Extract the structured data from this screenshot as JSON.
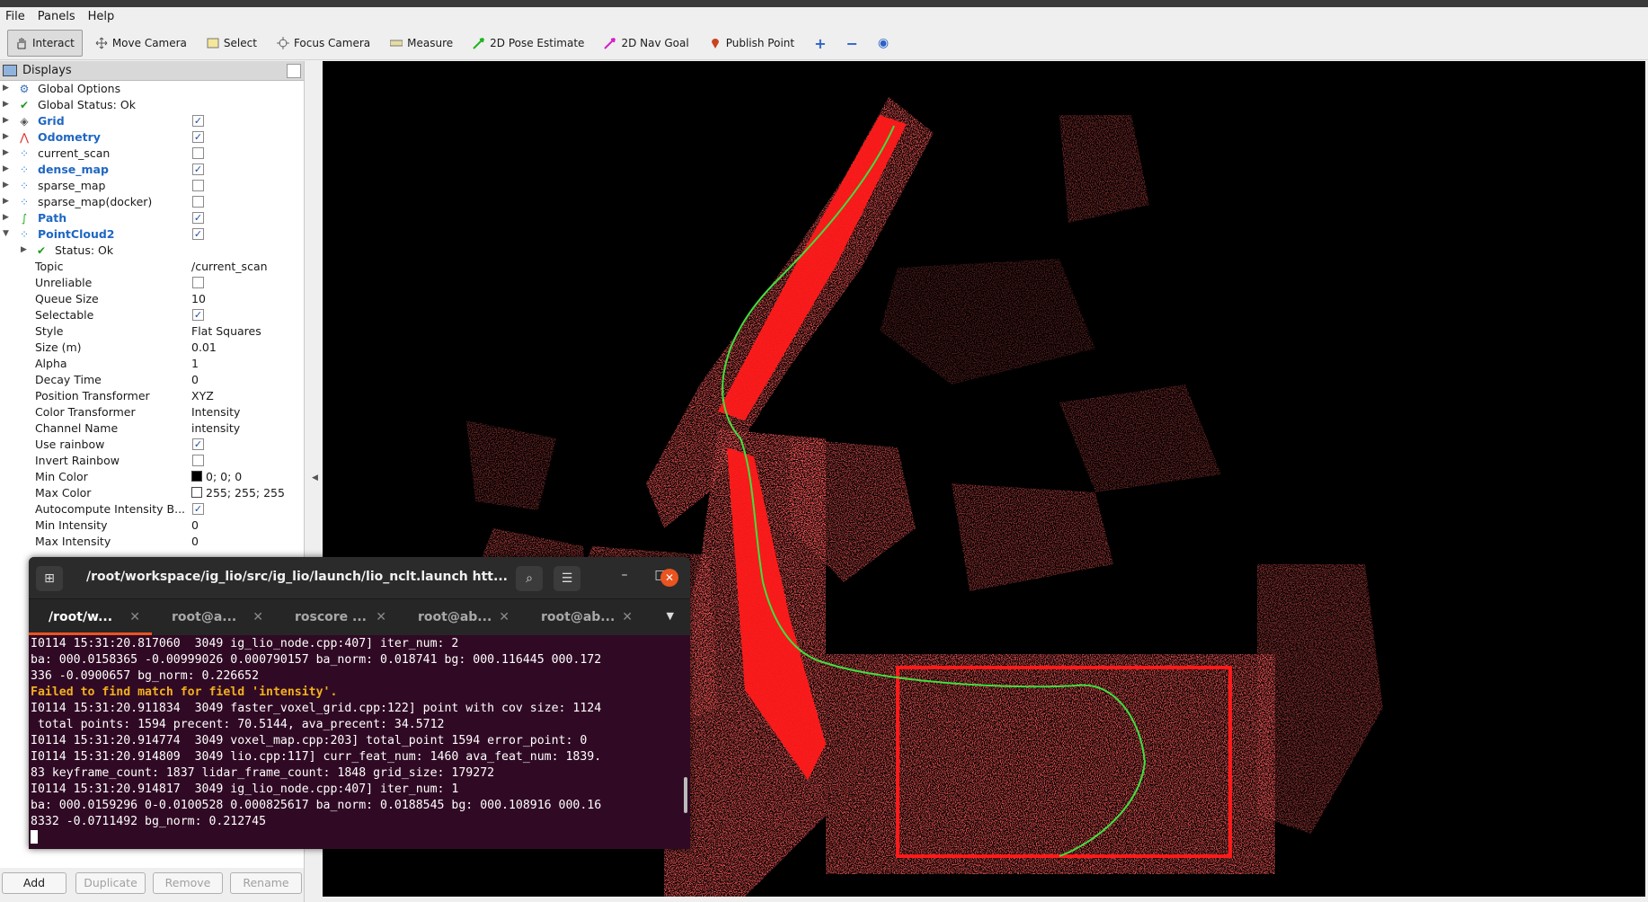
{
  "menu": [
    "File",
    "Panels",
    "Help"
  ],
  "toolbar": {
    "tools": [
      "Interact",
      "Move Camera",
      "Select",
      "Focus Camera",
      "Measure",
      "2D Pose Estimate",
      "2D Nav Goal",
      "Publish Point"
    ],
    "zoom_in": "+",
    "zoom_out": "−",
    "view": "◉"
  },
  "displays": {
    "title": "Displays",
    "items": [
      {
        "label": "Global Options",
        "icon": "globe-icon",
        "checked": null,
        "bold": false
      },
      {
        "label": "Global Status: Ok",
        "icon": "check-icon",
        "checked": null,
        "bold": false
      },
      {
        "label": "Grid",
        "icon": "grid-icon",
        "checked": true,
        "bold": true
      },
      {
        "label": "Odometry",
        "icon": "odometry-icon",
        "checked": true,
        "bold": true
      },
      {
        "label": "current_scan",
        "icon": "pointcloud-icon",
        "checked": false,
        "bold": false
      },
      {
        "label": "dense_map",
        "icon": "pointcloud-icon",
        "checked": true,
        "bold": true
      },
      {
        "label": "sparse_map",
        "icon": "pointcloud-icon",
        "checked": false,
        "bold": false
      },
      {
        "label": "sparse_map(docker)",
        "icon": "pointcloud-icon",
        "checked": false,
        "bold": false
      },
      {
        "label": "Path",
        "icon": "path-icon",
        "checked": true,
        "bold": true
      },
      {
        "label": "PointCloud2",
        "icon": "pointcloud-icon",
        "checked": true,
        "bold": true
      }
    ],
    "status_ok": "Status: Ok",
    "properties": [
      {
        "label": "Topic",
        "value": "/current_scan"
      },
      {
        "label": "Unreliable",
        "value": "",
        "checkbox": false
      },
      {
        "label": "Queue Size",
        "value": "10"
      },
      {
        "label": "Selectable",
        "value": "",
        "checkbox": true
      },
      {
        "label": "Style",
        "value": "Flat Squares"
      },
      {
        "label": "Size (m)",
        "value": "0.01"
      },
      {
        "label": "Alpha",
        "value": "1"
      },
      {
        "label": "Decay Time",
        "value": "0"
      },
      {
        "label": "Position Transformer",
        "value": "XYZ"
      },
      {
        "label": "Color Transformer",
        "value": "Intensity"
      },
      {
        "label": "Channel Name",
        "value": "intensity"
      },
      {
        "label": "Use rainbow",
        "value": "",
        "checkbox": true
      },
      {
        "label": "Invert Rainbow",
        "value": "",
        "checkbox": false
      },
      {
        "label": "Min Color",
        "value": "0; 0; 0",
        "swatch": "#000000"
      },
      {
        "label": "Max Color",
        "value": "255; 255; 255",
        "swatch": "#ffffff"
      },
      {
        "label": "Autocompute Intensity B...",
        "value": "",
        "checkbox": true
      },
      {
        "label": "Min Intensity",
        "value": "0"
      },
      {
        "label": "Max Intensity",
        "value": "0"
      }
    ]
  },
  "buttons": {
    "add": "Add",
    "duplicate": "Duplicate",
    "remove": "Remove",
    "rename": "Rename"
  },
  "terminal": {
    "title": "/root/workspace/ig_lio/src/ig_lio/launch/lio_nclt.launch htt...",
    "tabs": [
      "/root/w...",
      "root@a...",
      "roscore ...",
      "root@ab...",
      "root@ab..."
    ],
    "lines": [
      {
        "text": "I0114 15:31:20.817060  3049 ig_lio_node.cpp:407] iter_num: 2",
        "warn": false
      },
      {
        "text": "ba: 000.0158365 -0.00999026 0.000790157 ba_norm: 0.018741 bg: 000.116445 000.172",
        "warn": false
      },
      {
        "text": "336 -0.0900657 bg_norm: 0.226652",
        "warn": false
      },
      {
        "text": "Failed to find match for field 'intensity'.",
        "warn": true
      },
      {
        "text": "I0114 15:31:20.911834  3049 faster_voxel_grid.cpp:122] point with cov size: 1124",
        "warn": false
      },
      {
        "text": " total points: 1594 precent: 70.5144, ava_precent: 34.5712",
        "warn": false
      },
      {
        "text": "I0114 15:31:20.914774  3049 voxel_map.cpp:203] total_point 1594 error_point: 0",
        "warn": false
      },
      {
        "text": "I0114 15:31:20.914809  3049 lio.cpp:117] curr_feat_num: 1460 ava_feat_num: 1839.",
        "warn": false
      },
      {
        "text": "83 keyframe_count: 1837 lidar_frame_count: 1848 grid_size: 179272",
        "warn": false
      },
      {
        "text": "I0114 15:31:20.914817  3049 ig_lio_node.cpp:407] iter_num: 1",
        "warn": false
      },
      {
        "text": "ba: 000.0159296 0-0.0100528 0.000825617 ba_norm: 0.0188545 bg: 000.108916 000.16",
        "warn": false
      },
      {
        "text": "8332 -0.0711492 bg_norm: 0.212745",
        "warn": false
      }
    ]
  },
  "colors": {
    "map": "#ff1a1a",
    "path": "#3fe03f",
    "accent": "#e95420",
    "terminal_bg": "#300a24"
  }
}
